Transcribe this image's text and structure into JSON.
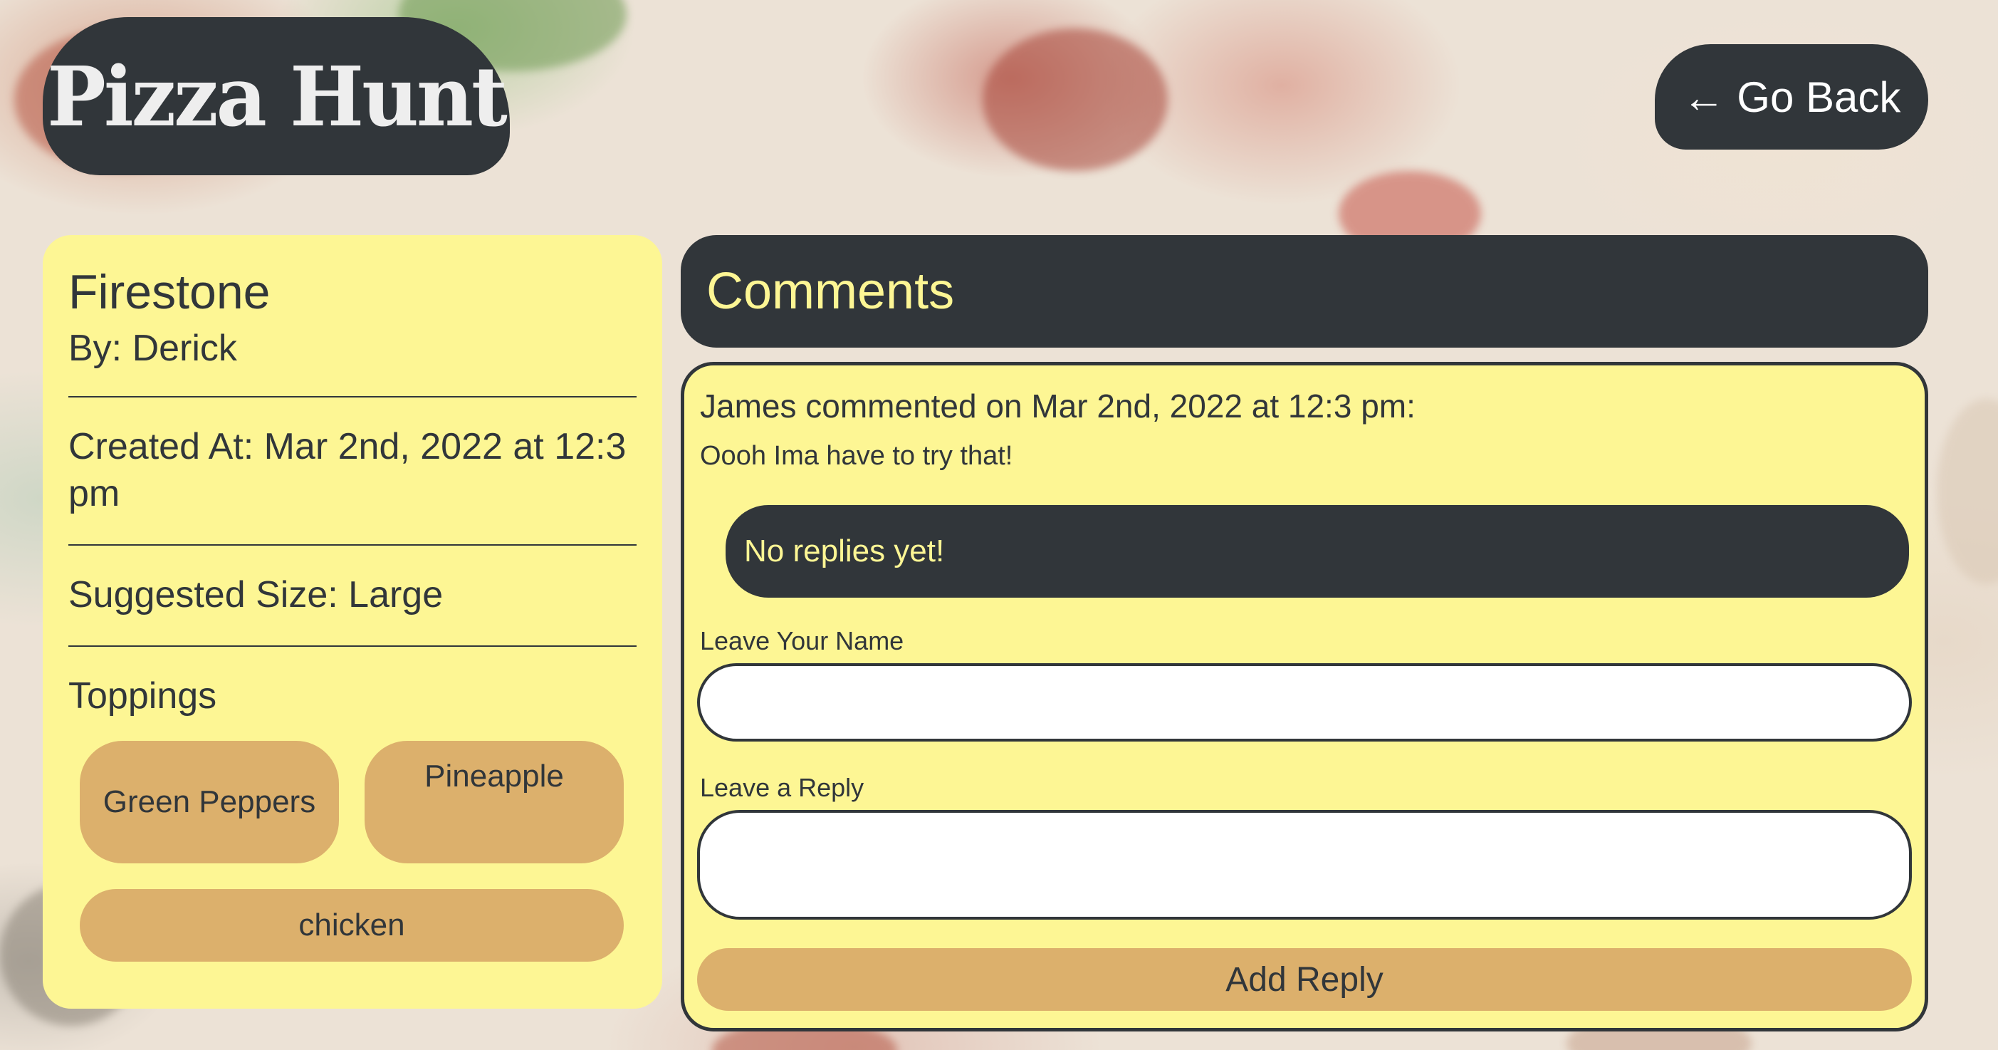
{
  "header": {
    "logo_text": "Pizza Hunt",
    "go_back_label": "← Go Back"
  },
  "pizza": {
    "name": "Firestone",
    "by": "By: Derick",
    "created_at": "Created At: Mar 2nd, 2022 at 12:3 pm",
    "suggested_size": "Suggested Size: Large",
    "toppings_title": "Toppings",
    "toppings": [
      "Green Peppers",
      "Pineapple",
      "chicken"
    ]
  },
  "comments": {
    "title": "Comments",
    "items": [
      {
        "header": "James commented on Mar 2nd, 2022 at 12:3 pm:",
        "body": "Oooh Ima have to try that!",
        "no_replies_text": "No replies yet!",
        "name_label": "Leave Your Name",
        "name_value": "",
        "reply_label": "Leave a Reply",
        "reply_value": "",
        "submit_label": "Add Reply"
      }
    ]
  },
  "colors": {
    "dark": "#31363a",
    "yellow": "#fdf694",
    "tan": "#dcb06c"
  }
}
